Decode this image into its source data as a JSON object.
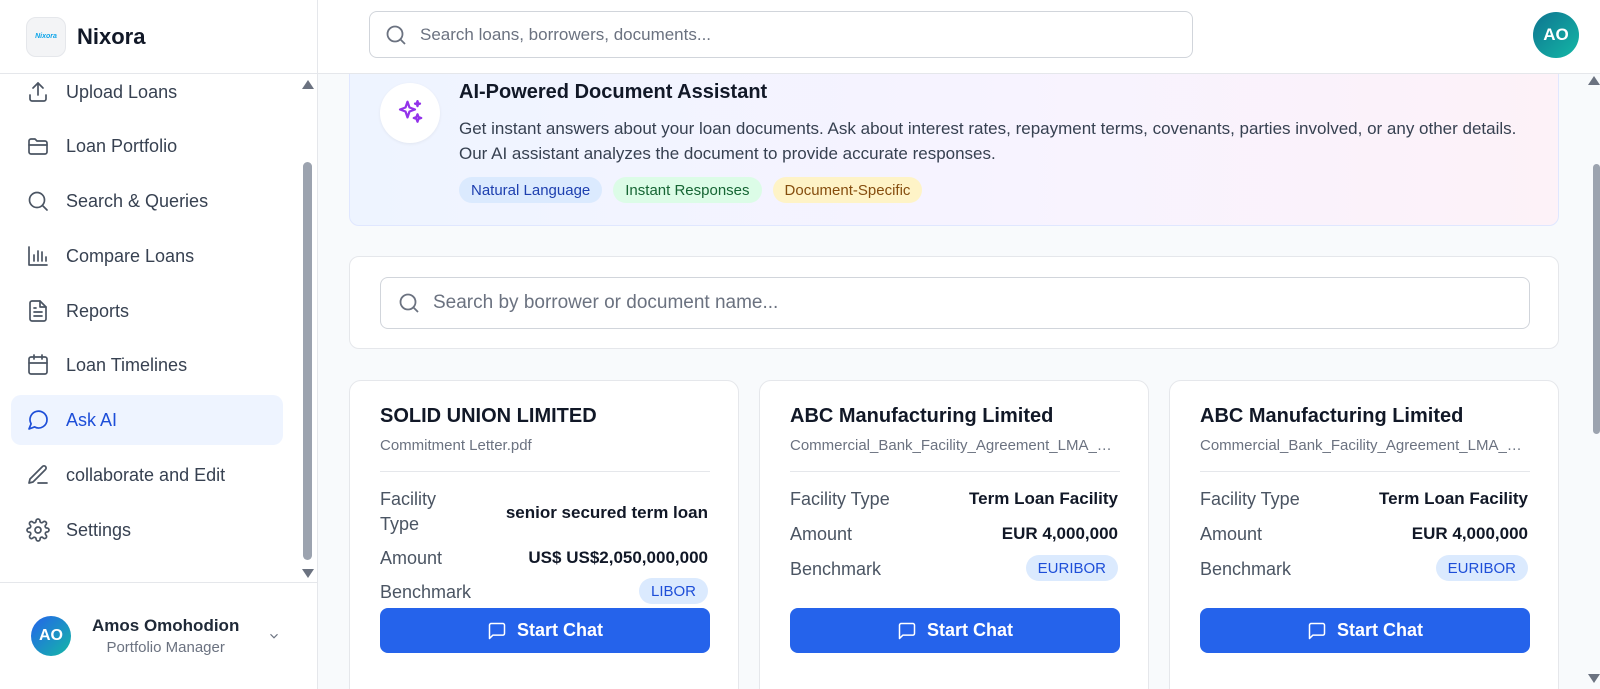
{
  "brand": {
    "name": "Nixora",
    "logo_text": "Nixora"
  },
  "header": {
    "search_placeholder": "Search loans, borrowers, documents...",
    "avatar_initials": "AO"
  },
  "sidebar": {
    "items": [
      {
        "label": "Upload Loans",
        "icon": "upload-icon"
      },
      {
        "label": "Loan Portfolio",
        "icon": "folder-icon"
      },
      {
        "label": "Search & Queries",
        "icon": "search-icon"
      },
      {
        "label": "Compare Loans",
        "icon": "bar-chart-icon"
      },
      {
        "label": "Reports",
        "icon": "document-icon"
      },
      {
        "label": "Loan Timelines",
        "icon": "calendar-icon"
      },
      {
        "label": "Ask AI",
        "icon": "chat-bubble-icon",
        "active": true
      },
      {
        "label": "collaborate and Edit",
        "icon": "pencil-icon"
      },
      {
        "label": "Settings",
        "icon": "gear-icon"
      }
    ],
    "user": {
      "initials": "AO",
      "name": "Amos Omohodion",
      "role": "Portfolio Manager"
    }
  },
  "ai_banner": {
    "title": "AI-Powered Document Assistant",
    "description": "Get instant answers about your loan documents. Ask about interest rates, repayment terms, covenants, parties involved, or any other details. Our AI assistant analyzes the document to provide accurate responses.",
    "chips": [
      "Natural Language",
      "Instant Responses",
      "Document-Specific"
    ]
  },
  "document_search": {
    "placeholder": "Search by borrower or document name..."
  },
  "row_labels": {
    "facility_type": "Facility Type",
    "amount": "Amount",
    "benchmark": "Benchmark"
  },
  "cards": [
    {
      "title": "SOLID UNION LIMITED",
      "file": "Commitment Letter.pdf",
      "facility_type": "senior secured term loan",
      "amount": "US$ US$2,050,000,000",
      "benchmark": "LIBOR",
      "button": "Start Chat"
    },
    {
      "title": "ABC Manufacturing Limited",
      "file": "Commercial_Bank_Facility_Agreement_LMA_Styl...",
      "facility_type": "Term Loan Facility",
      "amount": "EUR 4,000,000",
      "benchmark": "EURIBOR",
      "button": "Start Chat"
    },
    {
      "title": "ABC Manufacturing Limited",
      "file": "Commercial_Bank_Facility_Agreement_LMA_Styl...",
      "facility_type": "Term Loan Facility",
      "amount": "EUR 4,000,000",
      "benchmark": "EURIBOR",
      "button": "Start Chat"
    }
  ],
  "colors": {
    "primary": "#2563eb",
    "active_nav_bg": "#eef4ff",
    "ai_accent": "#9333ea"
  }
}
